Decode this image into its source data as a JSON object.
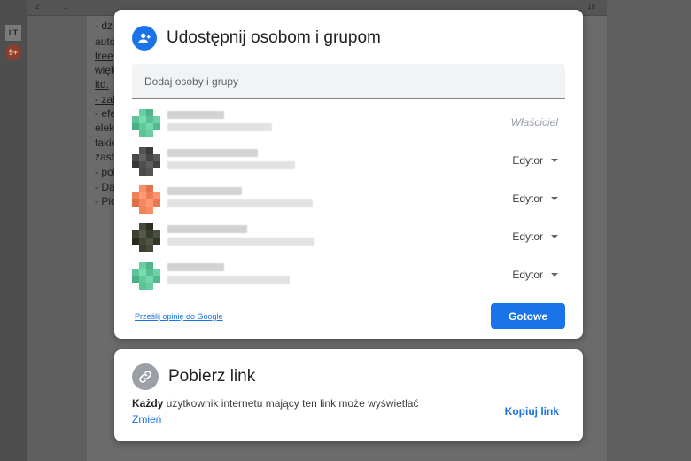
{
  "background": {
    "extension_lt": "LT",
    "extension_badge": "9+",
    "ruler_numbers": [
      "2",
      "1",
      "18"
    ],
    "doc_lines": [
      {
        "text": "- dz",
        "underline": false
      },
      {
        "text": "auto",
        "underline": false
      },
      {
        "text": "tree",
        "underline": true
      },
      {
        "text": "więk",
        "underline": false
      },
      {
        "text": "itd.",
        "underline": true
      },
      {
        "text": "- zał",
        "underline": true
      },
      {
        "text": "- efe",
        "underline": false
      },
      {
        "text": "elek",
        "underline": false
      },
      {
        "text": "takie",
        "underline": false
      },
      {
        "text": "zast",
        "underline": false
      },
      {
        "text": "- pol",
        "underline": false
      },
      {
        "text": "- Da",
        "underline": false
      },
      {
        "text": "- Pic",
        "underline": false
      }
    ]
  },
  "share_dialog": {
    "title": "Udostępnij osobom i grupom",
    "add_placeholder": "Dodaj osoby i grupy",
    "people": [
      {
        "role": "Właściciel",
        "is_owner": true,
        "avatar_color": "#5fc39a"
      },
      {
        "role": "Edytor",
        "is_owner": false,
        "avatar_color": "#4a4a4a"
      },
      {
        "role": "Edytor",
        "is_owner": false,
        "avatar_color": "#f0835c"
      },
      {
        "role": "Edytor",
        "is_owner": false,
        "avatar_color": "#3b4030"
      },
      {
        "role": "Edytor",
        "is_owner": false,
        "avatar_color": "#5fc39a"
      }
    ],
    "feedback_link": "Prześlij opinię do Google",
    "done_label": "Gotowe"
  },
  "link_dialog": {
    "title": "Pobierz link",
    "desc_bold": "Każdy",
    "desc_rest": " użytkownik internetu mający ten link może wyświetlać",
    "change_label": "Zmień",
    "copy_label": "Kopiuj link"
  },
  "colors": {
    "accent": "#1a73e8",
    "overlay": "#5f5f5f"
  }
}
